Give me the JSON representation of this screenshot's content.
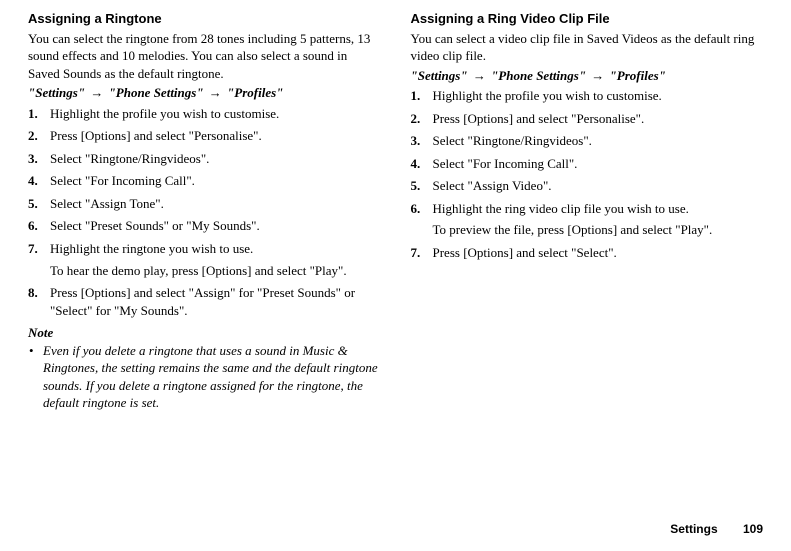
{
  "left": {
    "heading": "Assigning a Ringtone",
    "intro": "You can select the ringtone from 28 tones including 5 patterns, 13 sound effects and 10 melodies. You can also select a sound in Saved Sounds as the default ringtone.",
    "nav": {
      "a": "\"Settings\"",
      "b": "\"Phone Settings\"",
      "c": "\"Profiles\""
    },
    "steps": [
      {
        "text": "Highlight the profile you wish to customise."
      },
      {
        "text": "Press [Options] and select \"Personalise\"."
      },
      {
        "text": "Select \"Ringtone/Ringvideos\"."
      },
      {
        "text": "Select \"For Incoming Call\"."
      },
      {
        "text": "Select \"Assign Tone\"."
      },
      {
        "text": "Select \"Preset Sounds\" or \"My Sounds\"."
      },
      {
        "text": "Highlight the ringtone you wish to use.",
        "extra": "To hear the demo play, press [Options] and select \"Play\"."
      },
      {
        "text": "Press [Options] and select \"Assign\" for \"Preset Sounds\" or \"Select\" for \"My Sounds\"."
      }
    ],
    "note_label": "Note",
    "note_items": [
      "Even if you delete a ringtone that uses a sound in Music & Ringtones, the setting remains the same and the default ringtone sounds. If you delete a ringtone assigned for the ringtone, the default ringtone is set."
    ]
  },
  "right": {
    "heading": "Assigning a Ring Video Clip File",
    "intro": "You can select a video clip file in Saved Videos as the default ring video clip file.",
    "nav": {
      "a": "\"Settings\"",
      "b": "\"Phone Settings\"",
      "c": "\"Profiles\""
    },
    "steps": [
      {
        "text": "Highlight the profile you wish to customise."
      },
      {
        "text": "Press [Options] and select \"Personalise\"."
      },
      {
        "text": "Select \"Ringtone/Ringvideos\"."
      },
      {
        "text": "Select \"For Incoming Call\"."
      },
      {
        "text": "Select \"Assign Video\"."
      },
      {
        "text": "Highlight the ring video clip file you wish to use.",
        "extra": "To preview the file, press [Options] and select \"Play\"."
      },
      {
        "text": "Press [Options] and select \"Select\"."
      }
    ]
  },
  "footer": {
    "label": "Settings",
    "page": "109"
  }
}
